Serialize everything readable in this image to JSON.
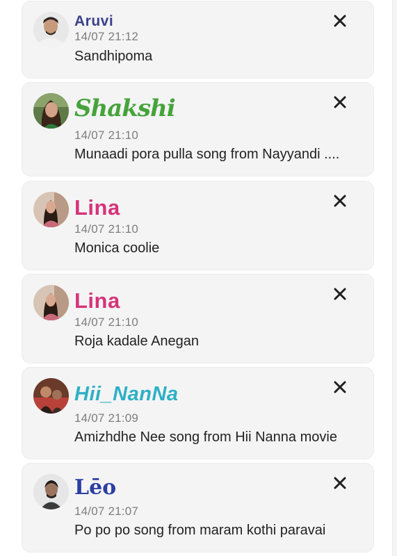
{
  "notifications": [
    {
      "username": "Aruvi",
      "time": "14/07 21:12",
      "message": "Sandhipoma"
    },
    {
      "username": "Shakshi",
      "time": "14/07 21:10",
      "message": "Munaadi pora pulla song from Nayyandi ...."
    },
    {
      "username": "Lina",
      "time": "14/07 21:10",
      "message": "Monica coolie"
    },
    {
      "username": "Lina",
      "time": "14/07 21:10",
      "message": "Roja kadale Anegan"
    },
    {
      "username": "Hii_NanNa",
      "time": "14/07 21:09",
      "message": "Amizhdhe Nee song from Hii Nanna movie"
    },
    {
      "username": "Lēo",
      "time": "14/07 21:07",
      "message": "Po po po song from maram kothi paravai"
    }
  ],
  "icons": {
    "dismiss": "close-icon",
    "avatar": "avatar"
  },
  "colors": {
    "card_bg": "#f4f4f4",
    "time_text": "#7d7d7d",
    "message_text": "#222222"
  }
}
